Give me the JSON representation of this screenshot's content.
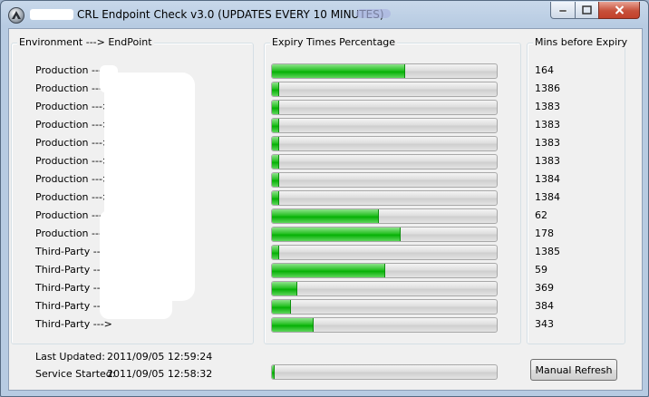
{
  "window": {
    "title": "CRL Endpoint Check v3.0 (UPDATES EVERY 10 MINUTES)",
    "icons": [
      "app-icon",
      "minimize-icon",
      "maximize-icon",
      "close-icon"
    ]
  },
  "columns": {
    "endpoint_header": "Environment ---> EndPoint",
    "expiry_header": "Expiry Times Percentage",
    "mins_header": "Mins before Expiry"
  },
  "rows": [
    {
      "env": "Production --->",
      "mins": "164",
      "fill_pct": 59
    },
    {
      "env": "Production --->",
      "mins": "1386",
      "fill_pct": 3
    },
    {
      "env": "Production --->",
      "mins": "1383",
      "fill_pct": 3
    },
    {
      "env": "Production --->",
      "mins": "1383",
      "fill_pct": 3
    },
    {
      "env": "Production --->",
      "mins": "1383",
      "fill_pct": 3
    },
    {
      "env": "Production --->",
      "mins": "1383",
      "fill_pct": 3
    },
    {
      "env": "Production --->",
      "mins": "1384",
      "fill_pct": 3
    },
    {
      "env": "Production --->",
      "mins": "1384",
      "fill_pct": 3
    },
    {
      "env": "Production --->",
      "mins": "62",
      "fill_pct": 47
    },
    {
      "env": "Production --->",
      "mins": "178",
      "fill_pct": 57
    },
    {
      "env": "Third-Party --->",
      "mins": "1385",
      "fill_pct": 3
    },
    {
      "env": "Third-Party --->",
      "mins": "59",
      "fill_pct": 50
    },
    {
      "env": "Third-Party --->",
      "mins": "369",
      "fill_pct": 11
    },
    {
      "env": "Third-Party --->",
      "mins": "384",
      "fill_pct": 8
    },
    {
      "env": "Third-Party --->",
      "mins": "343",
      "fill_pct": 18
    }
  ],
  "footer": {
    "last_updated_label": "Last Updated:",
    "last_updated_value": "2011/09/05 12:59:24",
    "service_started_label": "Service Started:",
    "service_started_value": "2011/09/05 12:58:32",
    "refresh_progress_pct": 1,
    "manual_refresh_label": "Manual Refresh"
  },
  "colors": {
    "progress_fill": "#06b006",
    "titlebar": "#b7cbe2",
    "close_button": "#c7503a"
  }
}
